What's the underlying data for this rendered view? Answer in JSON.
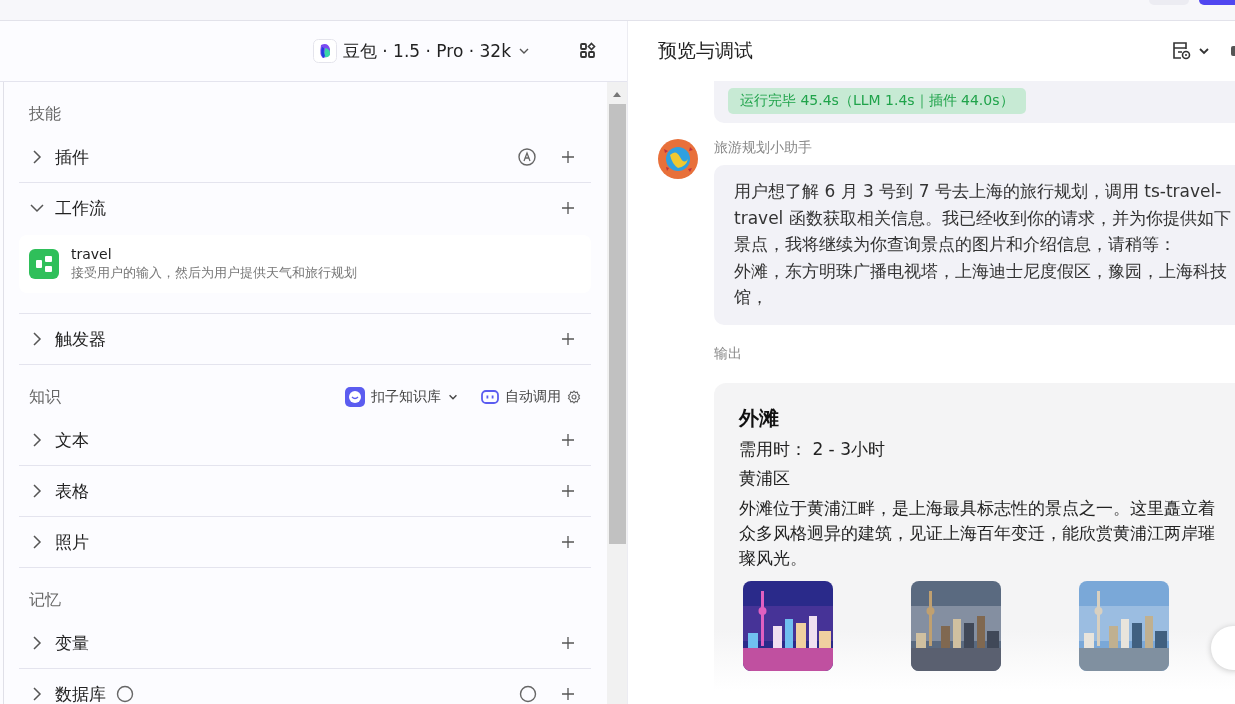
{
  "model": {
    "name": "豆包 · 1.5 · Pro · 32k"
  },
  "sections": [
    {
      "title": "技能",
      "items": [
        {
          "label": "插件",
          "expanded": false,
          "auto": true
        },
        {
          "label": "工作流",
          "expanded": true,
          "cards": [
            {
              "name": "travel",
              "description": "接受用户的输入，然后为用户提供天气和旅行规划"
            }
          ]
        },
        {
          "label": "触发器",
          "expanded": false
        }
      ]
    },
    {
      "title": "知识",
      "tools": [
        {
          "kind": "library",
          "label": "扣子知识库"
        },
        {
          "kind": "auto",
          "label": "自动调用"
        }
      ],
      "items": [
        {
          "label": "文本",
          "expanded": false
        },
        {
          "label": "表格",
          "expanded": false
        },
        {
          "label": "照片",
          "expanded": false
        }
      ]
    },
    {
      "title": "记忆",
      "items": [
        {
          "label": "变量",
          "expanded": false
        },
        {
          "label": "数据库",
          "expanded": false,
          "info": true
        }
      ]
    }
  ],
  "preview": {
    "title": "预览与调试",
    "status": "运行完毕 45.4s（LLM 1.4s｜插件 44.0s）",
    "sender": "旅游规划小助手",
    "message_lines": [
      "用户想了解 6 月 3 号到 7 号去上海的旅行规划，调用 ts-travel-",
      "travel 函数获取相关信息。我已经收到你的请求，并为你提供如下",
      "景点，我将继续为你查询景点的图片和介绍信息，请稍等：",
      "外滩，东方明珠广播电视塔，上海迪士尼度假区，豫园，上海科技",
      "馆，"
    ],
    "output_label": "输出",
    "place": {
      "title": "外滩",
      "duration": "需用时： 2 - 3小时",
      "district": "黄浦区",
      "description": "外滩位于黄浦江畔，是上海最具标志性的景点之一。这里矗立着众多风格迥异的建筑，见证上海百年变迁，能欣赏黄浦江两岸璀璨风光。"
    }
  }
}
